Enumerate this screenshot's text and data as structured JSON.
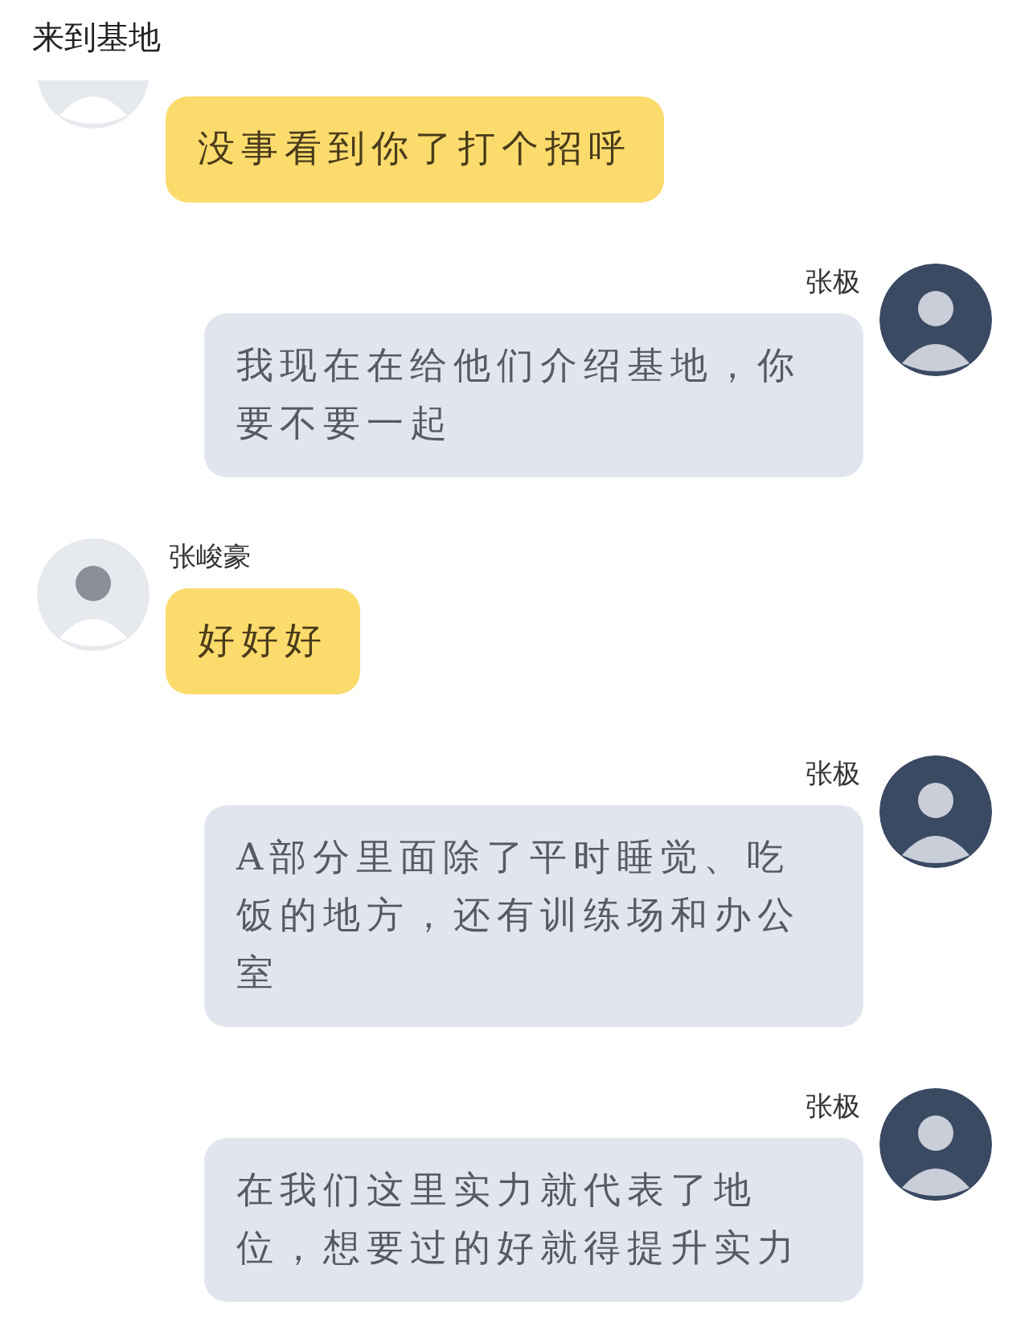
{
  "header": {
    "title": "来到基地"
  },
  "messages": [
    {
      "kind": "incoming",
      "text": "没事看到你了打个招呼"
    },
    {
      "kind": "outgoing",
      "sender": "张极",
      "text": "我现在在给他们介绍基地，你要不要一起"
    },
    {
      "kind": "incoming",
      "sender": "张峻豪",
      "text": "好好好"
    },
    {
      "kind": "outgoing",
      "sender": "张极",
      "text": "A部分里面除了平时睡觉、吃饭的地方，还有训练场和办公室"
    },
    {
      "kind": "outgoing",
      "sender": "张极",
      "text": "在我们这里实力就代表了地位，想要过的好就得提升实力"
    }
  ]
}
